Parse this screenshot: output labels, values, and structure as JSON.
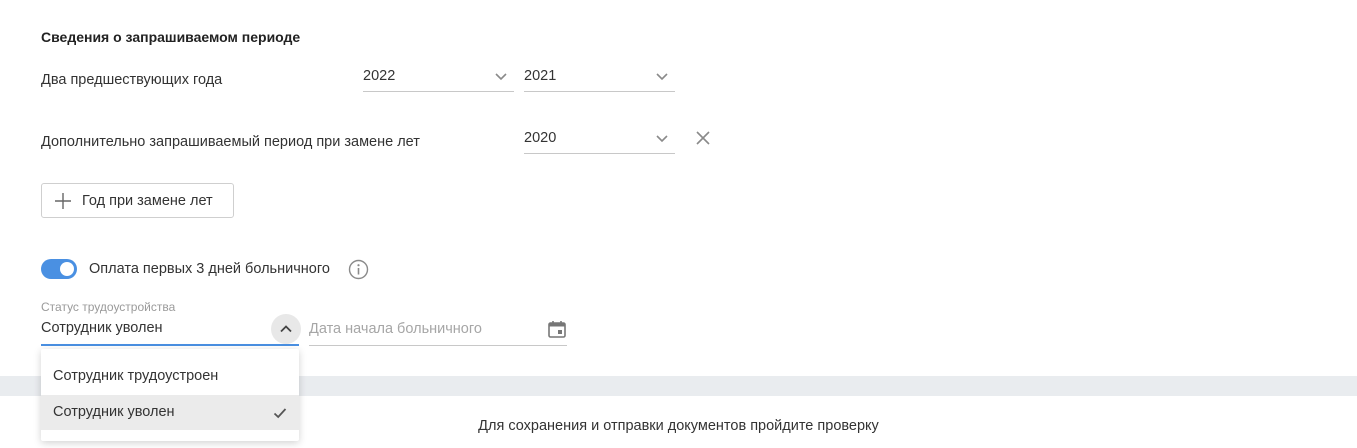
{
  "section": {
    "title": "Сведения о запрашиваемом периоде"
  },
  "years": {
    "label": "Два предшествующих года",
    "first_value": "2022",
    "second_value": "2021"
  },
  "extra_period": {
    "label": "Дополнительно запрашиваемый период при замене лет",
    "value": "2020"
  },
  "add_year_button": {
    "label": "Год при замене лет"
  },
  "sick_pay": {
    "toggle_label": "Оплата первых 3 дней больничного",
    "enabled": true,
    "accent_color": "#4a90e2"
  },
  "employment_status": {
    "caption": "Статус трудоустройства",
    "value": "Сотрудник уволен",
    "options": [
      {
        "label": "Сотрудник трудоустроен",
        "selected": false
      },
      {
        "label": "Сотрудник уволен",
        "selected": true
      }
    ]
  },
  "sick_leave_start": {
    "placeholder": "Дата начала больничного"
  },
  "footer": {
    "note": "Для сохранения и отправки документов пройдите проверку"
  },
  "icons": {
    "chevron": "chevron-down-icon",
    "close": "close-icon",
    "plus": "plus-icon",
    "info": "info-icon",
    "calendar": "calendar-icon",
    "check": "check-icon"
  }
}
